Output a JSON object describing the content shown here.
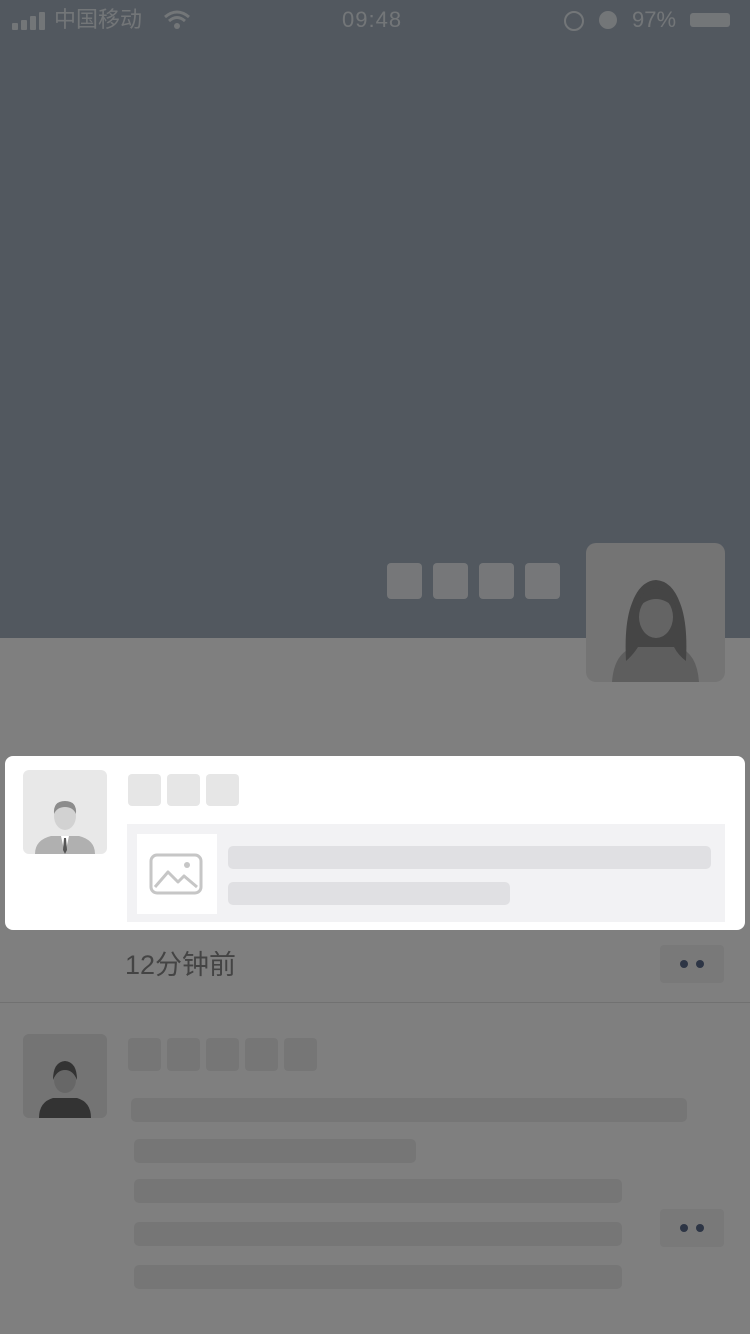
{
  "status_bar": {
    "carrier": "中国移动",
    "time": "09:48",
    "battery": "97%"
  },
  "icons": {
    "signal": "signal-icon",
    "wifi": "wifi-icon",
    "rotation_lock": "rotation-lock-icon",
    "alarm": "alarm-icon",
    "battery": "battery-icon",
    "image_placeholder": "image-icon",
    "more": "more-icon"
  },
  "feed": {
    "first_post": {
      "timestamp": "12分钟前"
    }
  },
  "colors": {
    "cover_background": "#a4b1bf",
    "overlay": "rgba(0,0,0,0.5)",
    "more_dots": "#5a6a8a"
  }
}
